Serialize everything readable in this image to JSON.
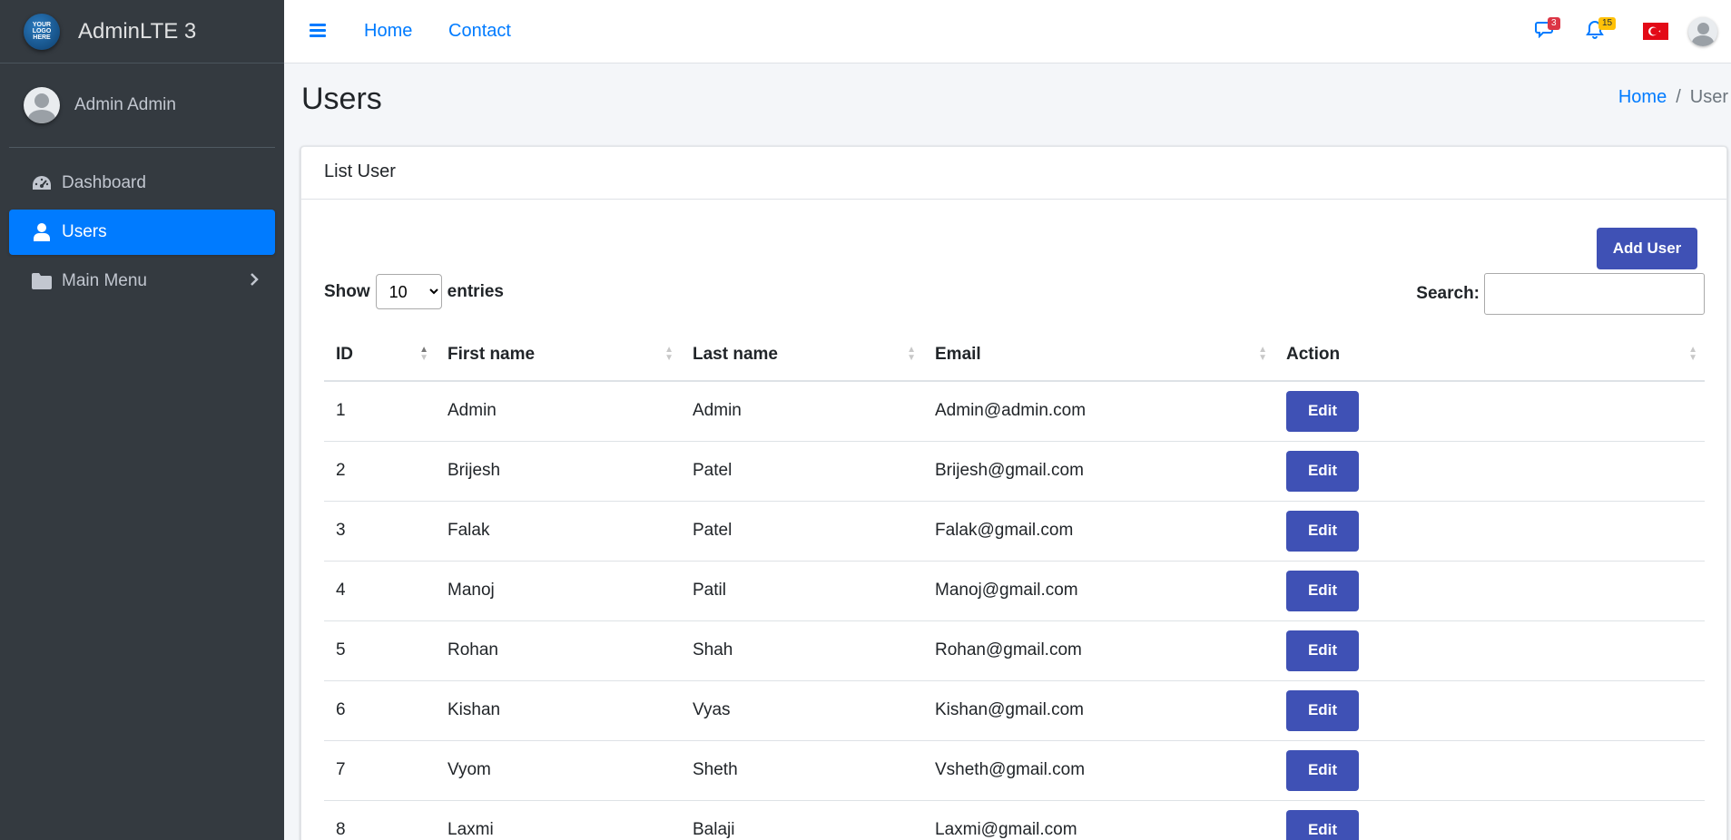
{
  "brand": {
    "name": "AdminLTE 3",
    "logo_text": "YOUR LOGO HERE"
  },
  "user": {
    "name": "Admin Admin"
  },
  "sidebar": {
    "items": [
      {
        "label": "Dashboard",
        "icon": "tachometer-icon"
      },
      {
        "label": "Users",
        "icon": "user-icon",
        "active": true
      },
      {
        "label": "Main Menu",
        "icon": "folder-icon"
      }
    ]
  },
  "topbar": {
    "links": [
      "Home",
      "Contact"
    ],
    "messages_count": "3",
    "notifications_count": "15"
  },
  "page": {
    "title": "Users"
  },
  "breadcrumb": {
    "home": "Home",
    "separator": "/",
    "current": "User"
  },
  "card": {
    "title": "List User",
    "add_button": "Add User",
    "show_label": "Show",
    "entries_label": "entries",
    "page_size": "10",
    "search_label": "Search:",
    "search_value": ""
  },
  "table": {
    "headers": [
      "ID",
      "First name",
      "Last name",
      "Email",
      "Action"
    ],
    "edit_label": "Edit",
    "rows": [
      {
        "id": "1",
        "first": "Admin",
        "last": "Admin",
        "email": "Admin@admin.com"
      },
      {
        "id": "2",
        "first": "Brijesh",
        "last": "Patel",
        "email": "Brijesh@gmail.com"
      },
      {
        "id": "3",
        "first": "Falak",
        "last": "Patel",
        "email": "Falak@gmail.com"
      },
      {
        "id": "4",
        "first": "Manoj",
        "last": "Patil",
        "email": "Manoj@gmail.com"
      },
      {
        "id": "5",
        "first": "Rohan",
        "last": "Shah",
        "email": "Rohan@gmail.com"
      },
      {
        "id": "6",
        "first": "Kishan",
        "last": "Vyas",
        "email": "Kishan@gmail.com"
      },
      {
        "id": "7",
        "first": "Vyom",
        "last": "Sheth",
        "email": "Vsheth@gmail.com"
      },
      {
        "id": "8",
        "first": "Laxmi",
        "last": "Balaji",
        "email": "Laxmi@gmail.com"
      }
    ]
  },
  "colors": {
    "primary": "#007bff",
    "button": "#3f51b5",
    "sidebar": "#343a40"
  }
}
